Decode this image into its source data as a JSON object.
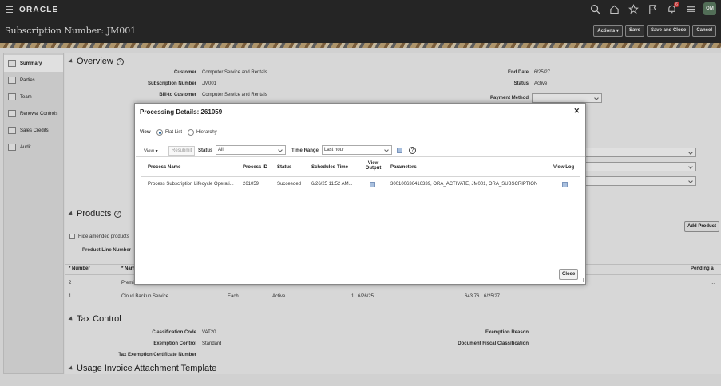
{
  "app": {
    "logo": "ORACLE",
    "user_initials": "OM",
    "notification_count": "6"
  },
  "page": {
    "title": "Subscription Number: JM001",
    "actions": [
      "Actions",
      "Save",
      "Save and Close",
      "Cancel"
    ]
  },
  "leftnav": {
    "items": [
      {
        "label": "Summary",
        "icon": "summary-icon"
      },
      {
        "label": "Parties",
        "icon": "parties-icon"
      },
      {
        "label": "Team",
        "icon": "team-icon"
      },
      {
        "label": "Renewal Controls",
        "icon": "renewal-icon"
      },
      {
        "label": "Sales Credits",
        "icon": "sales-credits-icon"
      },
      {
        "label": "Audit",
        "icon": "audit-icon"
      }
    ]
  },
  "overview": {
    "title": "Overview",
    "fields": [
      {
        "label": "Customer",
        "value": "Computer Service and Rentals"
      },
      {
        "label": "Subscription Number",
        "value": "JM001"
      },
      {
        "label": "Bill-to Customer",
        "value": "Computer Service and Rentals"
      }
    ],
    "right_fields": [
      {
        "label": "End Date",
        "value": "6/25/27"
      },
      {
        "label": "Status",
        "value": "Active"
      },
      {
        "label": "Payment Method",
        "value": ""
      }
    ]
  },
  "products": {
    "title": "Products",
    "hide_amended": "Hide amended products",
    "product_line_label": "Product Line Number",
    "add_product": "Add Product",
    "columns": {
      "number": "Number",
      "name": "Nam",
      "pending": "Pending a"
    },
    "rows": [
      {
        "number": "2",
        "name": "Premi",
        "uom": "",
        "status": "",
        "qty": "",
        "start": "",
        "amount": "",
        "end": "",
        "more": "..."
      },
      {
        "number": "1",
        "name": "Cloud Backup Service",
        "uom": "Each",
        "status": "Active",
        "qty": "1",
        "start": "6/26/25",
        "amount": "643.76",
        "end": "6/25/27",
        "more": "..."
      }
    ]
  },
  "tax": {
    "title": "Tax Control",
    "fields": [
      {
        "label": "Classification Code",
        "value": "VAT20"
      },
      {
        "label": "Exemption Control",
        "value": "Standard"
      },
      {
        "label": "Tax Exemption Certificate Number",
        "value": ""
      }
    ],
    "right_fields": [
      {
        "label": "Exemption Reason"
      },
      {
        "label": "Document Fiscal Classification"
      }
    ]
  },
  "usage": {
    "title": "Usage Invoice Attachment Template"
  },
  "dialog": {
    "title": "Processing Details: 261059",
    "view_label": "View",
    "view_options": [
      "Flat List",
      "Hierarchy"
    ],
    "toolbar": {
      "view_menu": "View",
      "resubmit": "Resubmit",
      "status_label": "Status",
      "status_value": "All",
      "time_range_label": "Time Range",
      "time_range_value": "Last hour"
    },
    "columns": [
      "Process Name",
      "Process ID",
      "Status",
      "Scheduled Time",
      "View Output",
      "Parameters",
      "View Log"
    ],
    "rows": [
      {
        "process_name": "Process Subscription Lifecycle Operati...",
        "process_id": "261059",
        "status": "Succeeded",
        "scheduled_time": "6/26/25 11:52 AM...",
        "parameters": "300100636416339, ORA_ACTIVATE, JM001, ORA_SUBSCRIPTION"
      }
    ],
    "close_button": "Close"
  }
}
